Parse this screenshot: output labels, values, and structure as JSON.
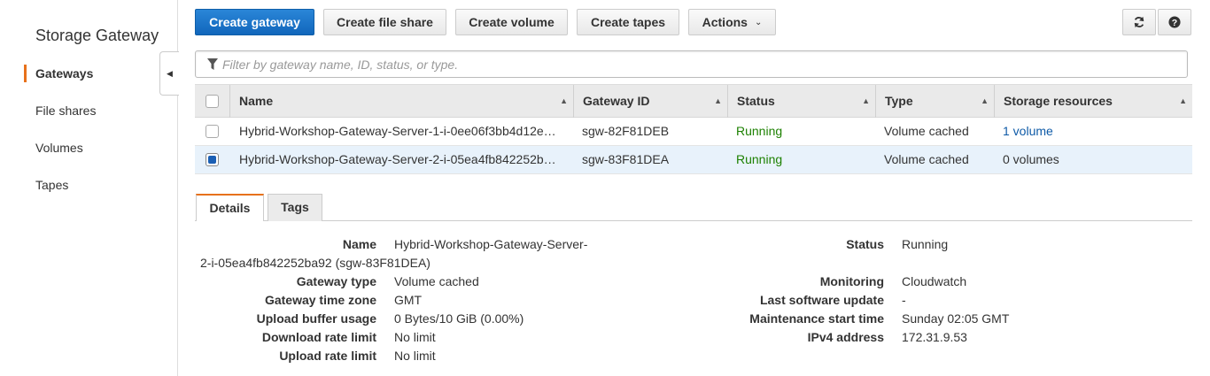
{
  "sidebar": {
    "title": "Storage Gateway",
    "items": [
      {
        "label": "Gateways",
        "active": true
      },
      {
        "label": "File shares"
      },
      {
        "label": "Volumes"
      },
      {
        "label": "Tapes"
      }
    ],
    "collapse_icon": "triangle-left-icon"
  },
  "toolbar": {
    "create_gateway": "Create gateway",
    "create_file_share": "Create file share",
    "create_volume": "Create volume",
    "create_tapes": "Create tapes",
    "actions": "Actions",
    "refresh_icon": "refresh-icon",
    "help_icon": "help-icon"
  },
  "filter": {
    "placeholder": "Filter by gateway name, ID, status, or type."
  },
  "table": {
    "columns": [
      "Name",
      "Gateway ID",
      "Status",
      "Type",
      "Storage resources"
    ],
    "rows": [
      {
        "name": "Hybrid-Workshop-Gateway-Server-1-i-0ee06f3bb4d12e…",
        "id": "sgw-82F81DEB",
        "status": "Running",
        "type": "Volume cached",
        "storage": "1 volume",
        "selected": false
      },
      {
        "name": "Hybrid-Workshop-Gateway-Server-2-i-05ea4fb842252b…",
        "id": "sgw-83F81DEA",
        "status": "Running",
        "type": "Volume cached",
        "storage": "0 volumes",
        "selected": true
      }
    ]
  },
  "tabs": [
    "Details",
    "Tags"
  ],
  "details": {
    "name_label": "Name",
    "name_value_line1": "Hybrid-Workshop-Gateway-Server-",
    "name_value_line2": "2-i-05ea4fb842252ba92 (sgw-83F81DEA)",
    "gateway_type_label": "Gateway type",
    "gateway_type_value": "Volume cached",
    "time_zone_label": "Gateway time zone",
    "time_zone_value": "GMT",
    "upload_buffer_label": "Upload buffer usage",
    "upload_buffer_value": "0 Bytes/10 GiB (0.00%)",
    "download_rate_label": "Download rate limit",
    "download_rate_value": "No limit",
    "upload_rate_label": "Upload rate limit",
    "upload_rate_value": "No limit",
    "status_label": "Status",
    "status_value": "Running",
    "monitoring_label": "Monitoring",
    "monitoring_value": "Cloudwatch",
    "last_update_label": "Last software update",
    "last_update_value": "-",
    "maintenance_label": "Maintenance start time",
    "maintenance_value": "Sunday 02:05 GMT",
    "ipv4_label": "IPv4 address",
    "ipv4_value": "172.31.9.53"
  },
  "colors": {
    "primary": "#1166bb",
    "accent": "#e7711b",
    "running": "#1d8102",
    "link": "#0e5aa7"
  }
}
